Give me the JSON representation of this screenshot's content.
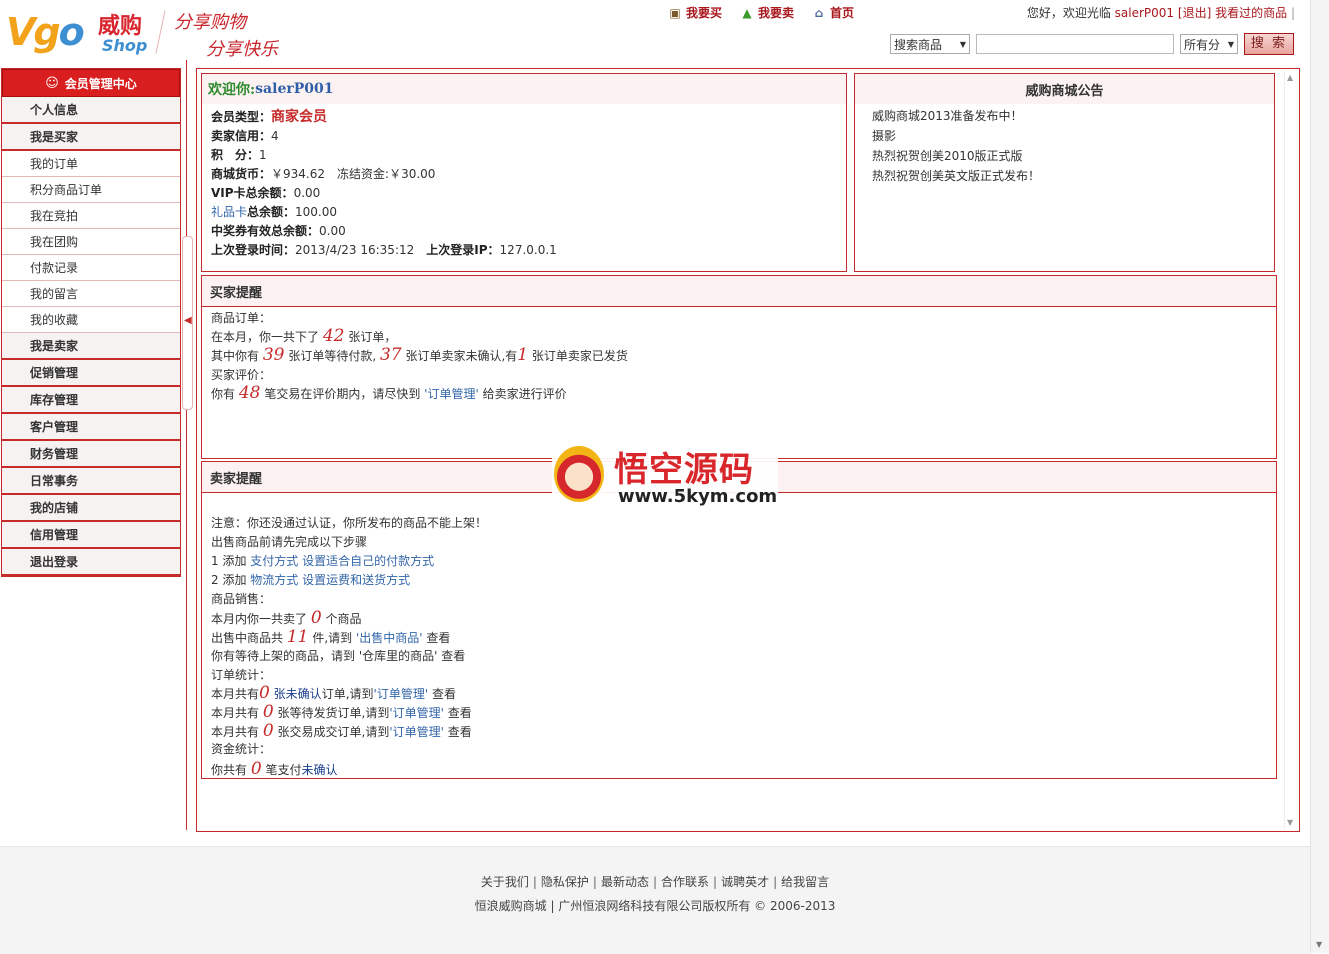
{
  "brand": {
    "logo_text_1": "Vg",
    "logo_text_2": "o",
    "logo_cn": "威购",
    "logo_en": "Shop",
    "slogan_1": "分享购物",
    "slogan_2": "分享快乐",
    "accent": "#c72a2a"
  },
  "topnav": [
    {
      "label": "我要买",
      "icon": "shopping-cart-icon"
    },
    {
      "label": "我要卖",
      "icon": "upload-arrow-icon"
    },
    {
      "label": "首页",
      "icon": "home-icon"
    }
  ],
  "welcome": {
    "greeting": "您好，欢迎光临",
    "username": "salerP001",
    "logout": "[退出]",
    "viewed": "我看过的商品",
    "sep": "|"
  },
  "search": {
    "type_value": "搜索商品",
    "input_value": "",
    "category_value": "所有分",
    "button": "搜 索"
  },
  "sidebar": {
    "header": "会员管理中心",
    "items": [
      {
        "label": "个人信息",
        "kind": "cat"
      },
      {
        "label": "我是买家",
        "kind": "cat"
      },
      {
        "label": "我的订单",
        "kind": "sub"
      },
      {
        "label": "积分商品订单",
        "kind": "sub"
      },
      {
        "label": "我在竞拍",
        "kind": "sub"
      },
      {
        "label": "我在团购",
        "kind": "sub"
      },
      {
        "label": "付款记录",
        "kind": "sub"
      },
      {
        "label": "我的留言",
        "kind": "sub"
      },
      {
        "label": "我的收藏",
        "kind": "sub"
      },
      {
        "label": "我是卖家",
        "kind": "cat"
      },
      {
        "label": "促销管理",
        "kind": "cat"
      },
      {
        "label": "库存管理",
        "kind": "cat"
      },
      {
        "label": "客户管理",
        "kind": "cat"
      },
      {
        "label": "财务管理",
        "kind": "cat"
      },
      {
        "label": "日常事务",
        "kind": "cat"
      },
      {
        "label": "我的店铺",
        "kind": "cat"
      },
      {
        "label": "信用管理",
        "kind": "cat"
      },
      {
        "label": "退出登录",
        "kind": "cat"
      }
    ]
  },
  "account": {
    "welcome_label": "欢迎你:",
    "welcome_user": "salerP001",
    "member_type_label": "会员类型：",
    "member_type": "商家会员",
    "seller_credit_label": "卖家信用：",
    "seller_credit": "4",
    "points_label": "积　分：",
    "points": "1",
    "currency_label": "商城货币：",
    "currency": "￥934.62",
    "frozen_label": "冻结资金:",
    "frozen": "￥30.00",
    "vip_label": "VIP卡总余额：",
    "vip": "0.00",
    "gift_link": "礼品卡",
    "gift_label": "总余额：",
    "gift": "100.00",
    "coupon_label": "中奖券有效总余额：",
    "coupon": "0.00",
    "last_login_label": "上次登录时间：",
    "last_login": "2013/4/23 16:35:12",
    "last_ip_label": "上次登录IP：",
    "last_ip": "127.0.0.1"
  },
  "notice": {
    "title": "威购商城公告",
    "items": [
      "威购商城2013准备发布中！",
      "摄影",
      "热烈祝贺创美2010版正式版",
      "热烈祝贺创美英文版正式发布！"
    ]
  },
  "buyer": {
    "title": "买家提醒",
    "orders_head": "商品订单：",
    "line1_a": "在本月，你一共下了",
    "total_orders": "42",
    "line1_b": "张订单，",
    "line2_a": "其中你有",
    "unpaid": "39",
    "line2_b": "张订单等待付款,",
    "unconfirmed": "37",
    "line2_c": "张订单卖家未确认,有",
    "shipped": "1",
    "line2_d": "张订单卖家已发货",
    "review_head": "买家评价：",
    "line3_a": "你有",
    "review_count": "48",
    "line3_b": "笔交易在评价期内，请尽快到",
    "line3_link": "'订单管理'",
    "line3_c": "给卖家进行评价"
  },
  "seller": {
    "title": "卖家提醒",
    "warn": "注意：你还没通过认证，你所发布的商品不能上架！",
    "steps_head": "出售商品前请先完成以下步骤",
    "step1_a": "1 添加",
    "step1_link1": "支付方式",
    "step1_link2": "设置适合自己的付款方式",
    "step2_a": "2 添加",
    "step2_link1": "物流方式",
    "step2_link2": "设置运费和送货方式",
    "sales_head": "商品销售：",
    "sold_a": "本月内你一共卖了",
    "sold": "0",
    "sold_b": "个商品",
    "onsale_a": "出售中商品共",
    "onsale": "11",
    "onsale_b": "件,请到",
    "onsale_link": "'出售中商品'",
    "onsale_c": "查看",
    "waiting": "你有等待上架的商品，请到 '仓库里的商品' 查看",
    "stats_head": "订单统计：",
    "o1_a": "本月共有",
    "o1_n": "0",
    "o1_link": "张未确认",
    "o1_b": "订单,请到",
    "o1_link2": "'订单管理'",
    "o1_c": "查看",
    "o2_a": "本月共有",
    "o2_n": "0",
    "o2_b": "张等待发货订单,请到",
    "o2_link": "'订单管理'",
    "o2_c": "查看",
    "o3_a": "本月共有",
    "o3_n": "0",
    "o3_b": "张交易成交订单,请到",
    "o3_link": "'订单管理'",
    "o3_c": "查看",
    "fund_head": "资金统计：",
    "f_a": "你共有",
    "f_n": "0",
    "f_b": "笔支付",
    "f_link": "未确认"
  },
  "watermark": {
    "title": "悟空源码",
    "url": "www.5kym.com"
  },
  "footer": {
    "links": [
      "关于我们",
      "隐私保护",
      "最新动态",
      "合作联系",
      "诚聘英才",
      "给我留言"
    ],
    "sep": "|",
    "copyright": "恒浪威购商城 | 广州恒浪网络科技有限公司版权所有 © 2006-2013"
  }
}
